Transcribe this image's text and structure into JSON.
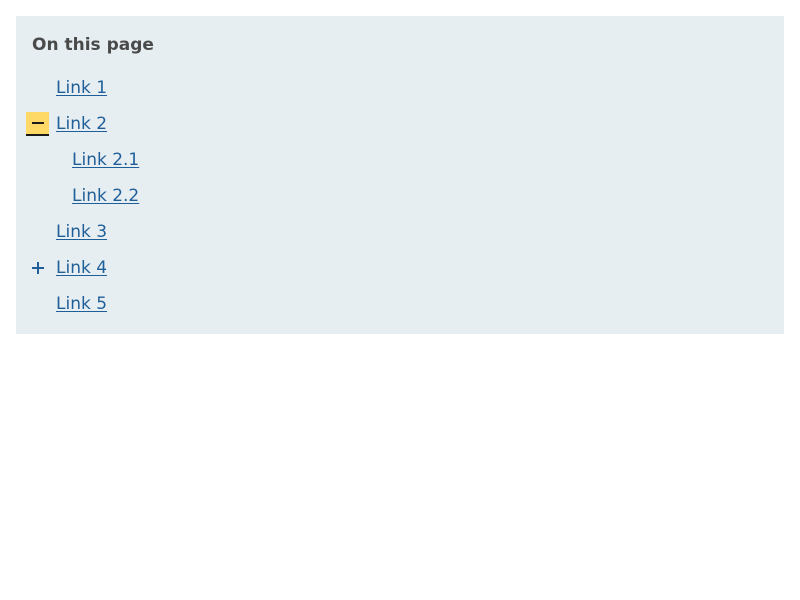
{
  "toc": {
    "title": "On this page",
    "items": [
      {
        "label": "Link 1"
      },
      {
        "label": "Link 2",
        "toggle": "collapse-icon",
        "expanded": true
      },
      {
        "label": "Link 2.1"
      },
      {
        "label": "Link 2.2"
      },
      {
        "label": "Link 3"
      },
      {
        "label": "Link 4",
        "toggle": "expand-icon",
        "expanded": false
      },
      {
        "label": "Link 5"
      }
    ]
  },
  "colors": {
    "panel_background": "#e6eef1",
    "link": "#1f5f99",
    "title": "#4a4a4a",
    "toggle_highlight": "#ffd966"
  }
}
